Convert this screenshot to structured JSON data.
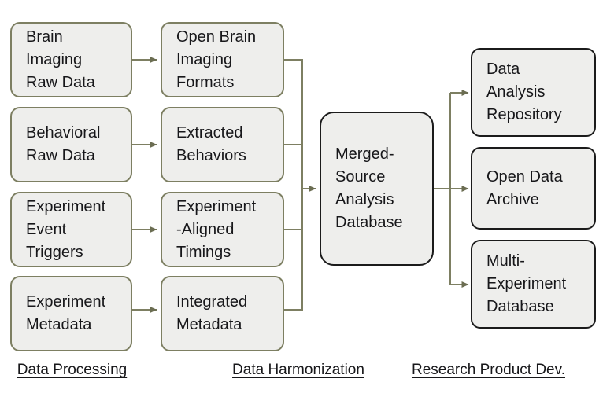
{
  "diagram": {
    "title": "Neuroscience data pipeline flow diagram",
    "colors": {
      "node_fill": "#eeeeec",
      "node_border_light": "#7d7f62",
      "node_border_dark": "#1b1b1b",
      "connector": "#7d7f62",
      "text": "#17171a",
      "background": "#ffffff"
    },
    "columns": {
      "raw_inputs": [
        {
          "id": "brain-imaging-raw-data",
          "label": "Brain\nImaging\nRaw Data"
        },
        {
          "id": "behavioral-raw-data",
          "label": "Behavioral\nRaw Data"
        },
        {
          "id": "experiment-event-triggers",
          "label": "Experiment\nEvent\nTriggers"
        },
        {
          "id": "experiment-metadata",
          "label": "Experiment\nMetadata"
        }
      ],
      "harmonized": [
        {
          "id": "open-brain-imaging-formats",
          "label": "Open Brain\nImaging\nFormats"
        },
        {
          "id": "extracted-behaviors",
          "label": "Extracted\nBehaviors"
        },
        {
          "id": "experiment-aligned-timings",
          "label": "Experiment\n-Aligned\nTimings"
        },
        {
          "id": "integrated-metadata",
          "label": "Integrated\nMetadata"
        }
      ],
      "merged": [
        {
          "id": "merged-source-analysis-database",
          "label": "Merged-\nSource\nAnalysis\nDatabase"
        }
      ],
      "products": [
        {
          "id": "data-analysis-repository",
          "label": "Data\nAnalysis\nRepository"
        },
        {
          "id": "open-data-archive",
          "label": "Open Data\nArchive"
        },
        {
          "id": "multi-experiment-database",
          "label": "Multi-\nExperiment\nDatabase"
        }
      ]
    },
    "phases": [
      {
        "id": "data-processing",
        "label": "Data Processing"
      },
      {
        "id": "data-harmonization",
        "label": "Data Harmonization"
      },
      {
        "id": "research-product-dev",
        "label": "Research Product Dev."
      }
    ]
  }
}
